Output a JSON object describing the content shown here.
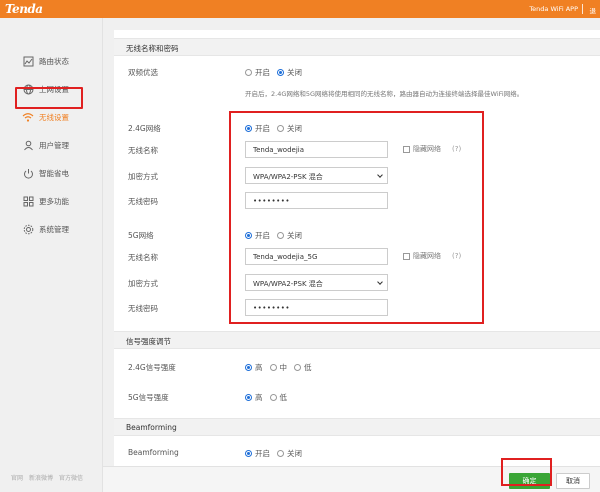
{
  "header": {
    "logo": "Tenda",
    "app_link": "Tenda WiFi APP",
    "more": "退"
  },
  "sidebar": {
    "items": [
      {
        "label": "路由状态",
        "icon": "chart-icon"
      },
      {
        "label": "上网设置",
        "icon": "globe-icon"
      },
      {
        "label": "无线设置",
        "icon": "wifi-icon"
      },
      {
        "label": "用户管理",
        "icon": "user-icon"
      },
      {
        "label": "智能省电",
        "icon": "power-icon"
      },
      {
        "label": "更多功能",
        "icon": "grid-icon"
      },
      {
        "label": "系统管理",
        "icon": "gear-icon"
      }
    ],
    "footer": [
      "官网",
      "新浪微博",
      "官方微信"
    ]
  },
  "sections": {
    "wireless_name": "无线名称和密码",
    "signal": "信号强度调节",
    "beamforming": "Beamforming"
  },
  "dual_band": {
    "label": "双频优选",
    "on": "开启",
    "off": "关闭",
    "hint": "开启后，2.4G网络和5G网络将使用相同的无线名称，路由器自动为连接终端选择最佳WiFi网络。"
  },
  "band24": {
    "label": "2.4G网络",
    "on": "开启",
    "off": "关闭",
    "ssid_label": "无线名称",
    "ssid": "Tenda_wodejia",
    "hide_label": "隐藏网络",
    "help": "(?)",
    "enc_label": "加密方式",
    "enc": "WPA/WPA2-PSK 混合",
    "pwd_label": "无线密码",
    "pwd": "••••••••"
  },
  "band5": {
    "label": "5G网络",
    "on": "开启",
    "off": "关闭",
    "ssid_label": "无线名称",
    "ssid": "Tenda_wodejia_5G",
    "hide_label": "隐藏网络",
    "help": "(?)",
    "enc_label": "加密方式",
    "enc": "WPA/WPA2-PSK 混合",
    "pwd_label": "无线密码",
    "pwd": "••••••••"
  },
  "signal": {
    "band24_label": "2.4G信号强度",
    "high": "高",
    "mid": "中",
    "low": "低",
    "band5_label": "5G信号强度",
    "high5": "高",
    "low5": "低"
  },
  "beam": {
    "label": "Beamforming",
    "on": "开启",
    "off": "关闭"
  },
  "buttons": {
    "ok": "确定",
    "cancel": "取消"
  },
  "colors": {
    "brand": "#f08023",
    "ok": "#3aa536",
    "highlight": "#e02020",
    "radio": "#1e6fd9"
  }
}
